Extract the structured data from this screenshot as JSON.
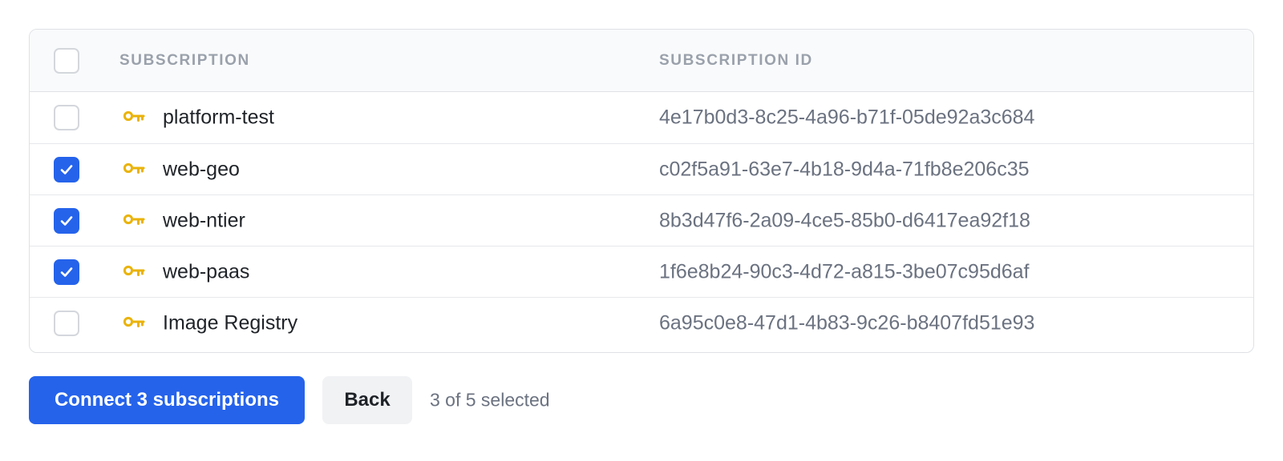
{
  "table": {
    "columns": {
      "subscription": "SUBSCRIPTION",
      "subscription_id": "SUBSCRIPTION ID"
    },
    "select_all_checked": false,
    "rows": [
      {
        "name": "platform-test",
        "id": "4e17b0d3-8c25-4a96-b71f-05de92a3c684",
        "checked": false,
        "icon": "key-icon"
      },
      {
        "name": "web-geo",
        "id": "c02f5a91-63e7-4b18-9d4a-71fb8e206c35",
        "checked": true,
        "icon": "key-icon"
      },
      {
        "name": "web-ntier",
        "id": "8b3d47f6-2a09-4ce5-85b0-d6417ea92f18",
        "checked": true,
        "icon": "key-icon"
      },
      {
        "name": "web-paas",
        "id": "1f6e8b24-90c3-4d72-a815-3be07c95d6af",
        "checked": true,
        "icon": "key-icon"
      },
      {
        "name": "Image Registry",
        "id": "6a95c0e8-47d1-4b83-9c26-b8407fd51e93",
        "checked": false,
        "icon": "key-icon"
      }
    ]
  },
  "actions": {
    "connect_label": "Connect 3 subscriptions",
    "back_label": "Back",
    "selection_status": "3 of 5 selected"
  },
  "colors": {
    "accent": "#2563eb",
    "key_icon": "#eab308",
    "header_text": "#9aa1ab",
    "id_text": "#6b7280"
  }
}
